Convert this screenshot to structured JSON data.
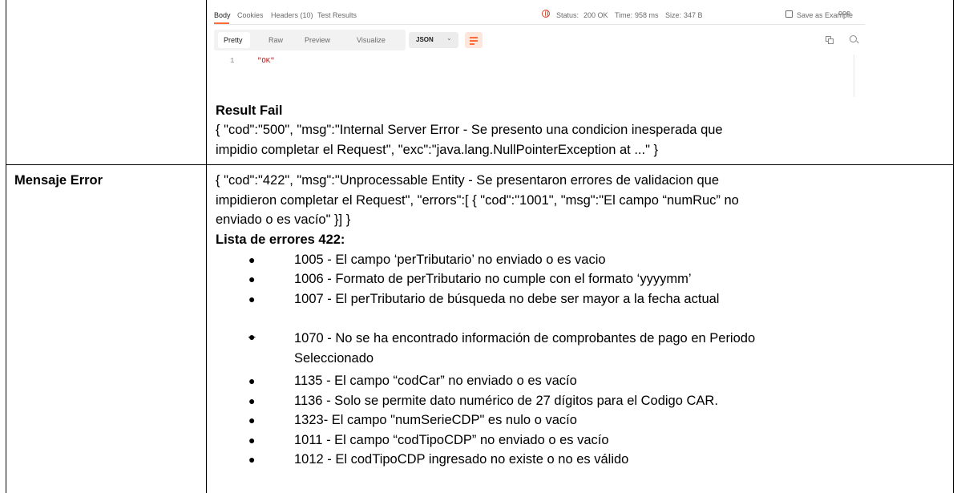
{
  "postman": {
    "tabs": [
      "Body",
      "Cookies",
      "Headers (10)",
      "Test Results"
    ],
    "status_label": "Status:",
    "status_value": "200 OK",
    "time_label": "Time:",
    "time_value": "958 ms",
    "size_label": "Size:",
    "size_value": "347 B",
    "save_label": "Save as Example",
    "more": "ooo",
    "view_modes": [
      "Pretty",
      "Raw",
      "Preview",
      "Visualize"
    ],
    "format": "JSON",
    "line_number": "1",
    "response_body": "\"OK\"",
    "colors": {
      "accent": "#ff6c37",
      "status_ok": "#0c8e3d",
      "string": "#a31515"
    }
  },
  "result_fail": {
    "heading": "Result Fail",
    "lines": [
      "{ \"cod\":\"500\", \"msg\":\"Internal Server Error - Se presento una condicion inesperada que",
      "impidio completar el Request\", \"exc\":\"java.lang.NullPointerException at ...\" }"
    ]
  },
  "mensaje_error": {
    "label": "Mensaje Error",
    "lines": [
      "{ \"cod\":\"422\", \"msg\":\"Unprocessable Entity - Se presentaron errores de validacion que",
      "impidieron completar el Request\", \"errors\":[ { \"cod\":\"1001\", \"msg\":\"El campo “numRuc” no",
      "enviado o es vacío\" }] }"
    ],
    "list_heading": "Lista de errores 422:",
    "errors": [
      "1005 - El campo ‘perTributario’ no enviado o es vacio",
      "1006 - Formato de perTributario no cumple con el formato ‘yyyymm’",
      "1007 - El perTributario de búsqueda no debe ser mayor a la fecha actual",
      "1070 - No se ha encontrado información de comprobantes de pago en Periodo",
      "Seleccionado",
      "1135 - El campo “codCar” no enviado o es vacío",
      "1136 - Solo se permite dato numérico de 27 dígitos para el Codigo CAR.",
      "1323- El campo \"numSerieCDP\" es nulo o vacío",
      "1011 - El campo “codTipoCDP” no enviado o es vacío",
      "1012 - El codTipoCDP ingresado no existe o no es válido"
    ],
    "bullet": "●"
  }
}
